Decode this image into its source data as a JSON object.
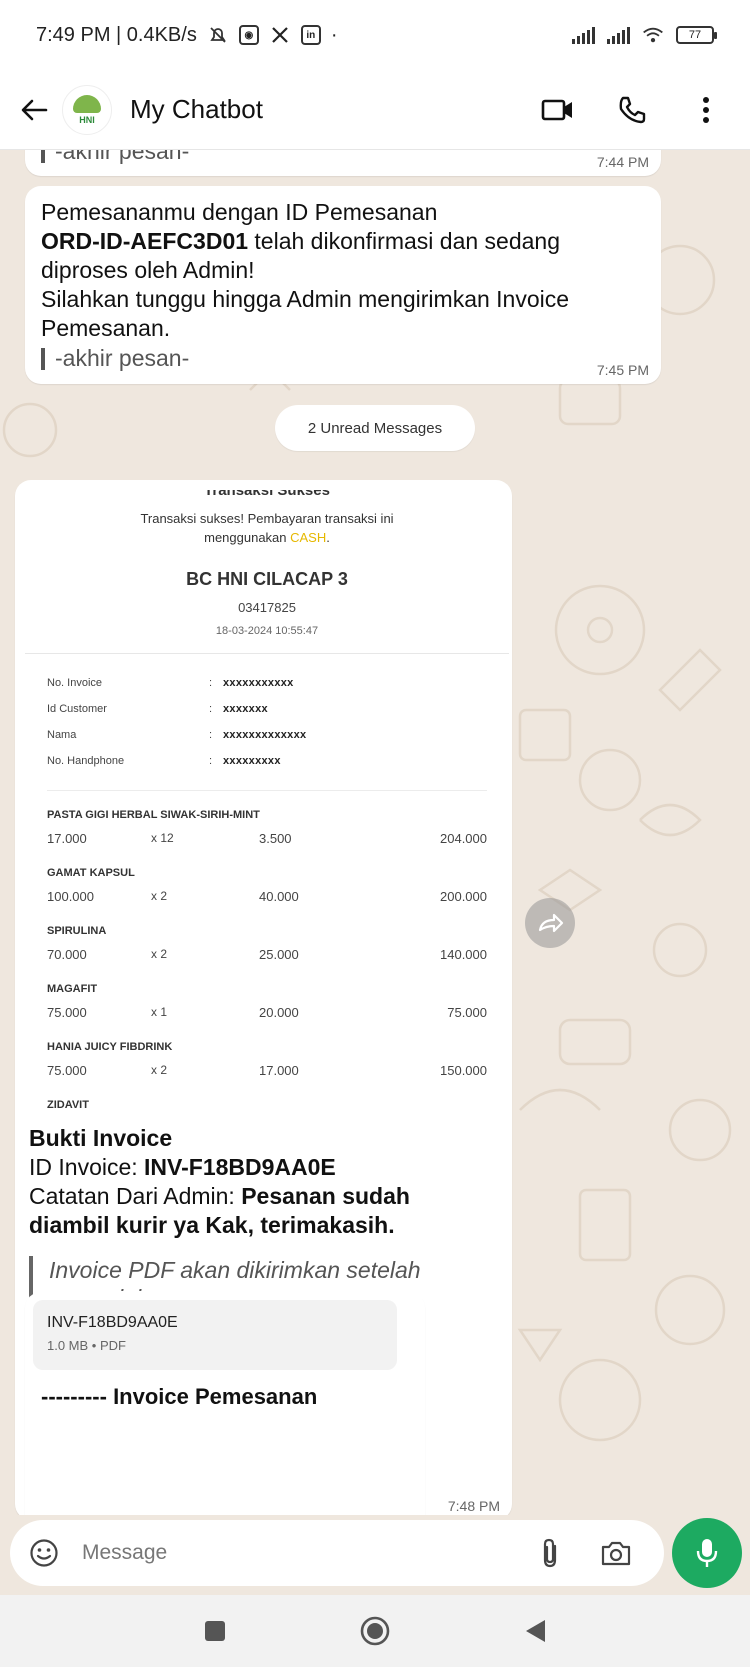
{
  "status_bar": {
    "time_speed": "7:49 PM | 0.4KB/s",
    "battery": "77"
  },
  "header": {
    "title": "My Chatbot",
    "avatar_text": "HNI"
  },
  "messages": {
    "msg1": {
      "quote": "-akhir pesan-",
      "time": "7:44 PM"
    },
    "msg2": {
      "line1": "Pemesananmu dengan ID Pemesanan",
      "order_id": "ORD-ID-AEFC3D01",
      "line2_rest": " telah dikonfirmasi dan sedang",
      "line3": "diproses oleh Admin!",
      "line4": "Silahkan tunggu hingga Admin mengirimkan Invoice",
      "line5": "Pemesanan.",
      "quote": "-akhir pesan-",
      "time": "7:45 PM"
    },
    "unread": "2 Unread Messages",
    "receipt": {
      "heading_cut": "Transaksi Sukses",
      "desc_1": "Transaksi sukses! Pembayaran transaksi ini",
      "desc_2": "menggunakan ",
      "cash": "CASH",
      "period": ".",
      "merchant": "BC HNI CILACAP 3",
      "code": "03417825",
      "datetime": "18-03-2024 10:55:47",
      "info": [
        {
          "label": "No. Invoice",
          "value": "xxxxxxxxxxx"
        },
        {
          "label": "Id Customer",
          "value": "xxxxxxx"
        },
        {
          "label": "Nama",
          "value": "xxxxxxxxxxxxx"
        },
        {
          "label": "No. Handphone",
          "value": "xxxxxxxxx"
        }
      ],
      "items": [
        {
          "name": "PASTA GIGI HERBAL SIWAK-SIRIH-MINT",
          "price": "17.000",
          "qty": "x 12",
          "unit": "3.500",
          "total": "204.000"
        },
        {
          "name": "GAMAT KAPSUL",
          "price": "100.000",
          "qty": "x 2",
          "unit": "40.000",
          "total": "200.000"
        },
        {
          "name": "SPIRULINA",
          "price": "70.000",
          "qty": "x 2",
          "unit": "25.000",
          "total": "140.000"
        },
        {
          "name": "MAGAFIT",
          "price": "75.000",
          "qty": "x 1",
          "unit": "20.000",
          "total": "75.000"
        },
        {
          "name": "HANIA JUICY FIBDRINK",
          "price": "75.000",
          "qty": "x 2",
          "unit": "17.000",
          "total": "150.000"
        }
      ],
      "last_item": "ZIDAVIT"
    },
    "invoice": {
      "title": "Bukti Invoice",
      "id_label": "ID Invoice: ",
      "id_value": "INV-F18BD9AA0E",
      "note_label": "Catatan Dari Admin: ",
      "note_value_1": "Pesanan sudah",
      "note_value_2": "diambil kurir ya Kak, terimakasih.",
      "quote_1": "Invoice PDF akan dikirimkan setelah",
      "quote_2": "pesan ini.",
      "time": "7:48 PM"
    },
    "document": {
      "name": "INV-F18BD9AA0E",
      "meta": "1.0 MB • PDF",
      "caption_dashes": "--------- ",
      "caption": "Invoice Pemesanan"
    }
  },
  "composer": {
    "placeholder": "Message"
  },
  "colors": {
    "mic_green": "#1daa61",
    "chat_bg": "#efe7de",
    "cash_yellow": "#e6b800"
  }
}
